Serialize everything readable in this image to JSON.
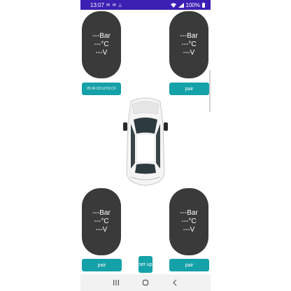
{
  "status_bar": {
    "time": "13:07",
    "notif_icons": "✉ ✉ △",
    "battery": "100%"
  },
  "tires": {
    "front_left": {
      "pressure": "---Bar",
      "temperature": "---°C",
      "voltage": "---V"
    },
    "front_right": {
      "pressure": "---Bar",
      "temperature": "---°C",
      "voltage": "---V"
    },
    "rear_left": {
      "pressure": "---Bar",
      "temperature": "---°C",
      "voltage": "---V"
    },
    "rear_right": {
      "pressure": "---Bar",
      "temperature": "---°C",
      "voltage": "---V"
    }
  },
  "buttons": {
    "front_left": "05:3F:03:12:01:CF",
    "front_right": "pair",
    "rear_left": "pair",
    "rear_right": "pair",
    "setup": "set up"
  },
  "colors": {
    "status_bar": "#3c1fb3",
    "tire_bg": "#3a3a3a",
    "button": "#15a1a8"
  },
  "nav_icons": [
    "recent-apps-icon",
    "home-icon",
    "back-icon"
  ]
}
